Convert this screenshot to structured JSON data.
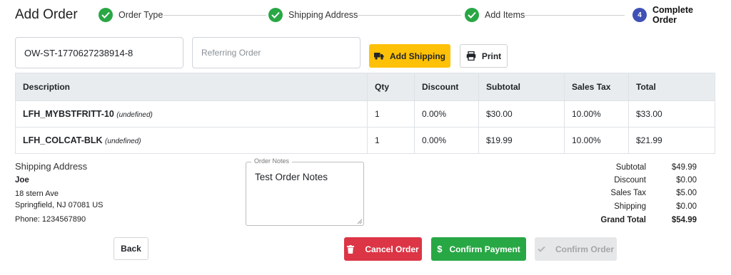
{
  "header": {
    "title": "Add Order",
    "steps": [
      {
        "label": "Order Type",
        "status": "done"
      },
      {
        "label": "Shipping Address",
        "status": "done"
      },
      {
        "label": "Add Items",
        "status": "done"
      },
      {
        "label": "Complete Order",
        "status": "active",
        "number": "4"
      }
    ]
  },
  "form": {
    "order_id": "OW-ST-1770627238914-8",
    "referring_order_placeholder": "Referring Order",
    "add_shipping_label": "Add Shipping",
    "print_label": "Print"
  },
  "table": {
    "headers": [
      "Description",
      "Qty",
      "Discount",
      "Subtotal",
      "Sales Tax",
      "Total"
    ],
    "rows": [
      {
        "sku": "LFH_MYBSTFRITT-10",
        "note": "(undefined)",
        "qty": "1",
        "discount": "0.00%",
        "subtotal": "$30.00",
        "sales_tax": "10.00%",
        "total": "$33.00"
      },
      {
        "sku": "LFH_COLCAT-BLK",
        "note": "(undefined)",
        "qty": "1",
        "discount": "0.00%",
        "subtotal": "$19.99",
        "sales_tax": "10.00%",
        "total": "$21.99"
      }
    ]
  },
  "shipping": {
    "heading": "Shipping Address",
    "name": "Joe",
    "street": "18 stern Ave",
    "city_line": "Springfield, NJ 07081 US",
    "phone": "Phone: 1234567890"
  },
  "notes": {
    "legend": "Order Notes",
    "value": "Test Order Notes"
  },
  "totals": [
    {
      "label": "Subtotal",
      "value": "$49.99"
    },
    {
      "label": "Discount",
      "value": "$0.00"
    },
    {
      "label": "Sales Tax",
      "value": "$5.00"
    },
    {
      "label": "Shipping",
      "value": "$0.00"
    },
    {
      "label": "Grand Total",
      "value": "$54.99"
    }
  ],
  "actions": {
    "back": "Back",
    "cancel": "Cancel Order",
    "confirm_payment": "Confirm Payment",
    "confirm_order": "Confirm Order"
  },
  "colors": {
    "step_done": "#28a745",
    "step_active": "#3f51b5",
    "shipping_button": "#ffc107",
    "cancel_button": "#dc3545",
    "confirm_payment_button": "#28a745",
    "confirm_order_disabled": "#e6e7e8"
  },
  "icons": {
    "step_done": "check-circle-icon",
    "add_shipping": "truck-icon",
    "print": "printer-icon",
    "cancel": "trash-icon",
    "confirm_payment": "dollar-icon",
    "confirm_order": "checkmark-icon"
  }
}
